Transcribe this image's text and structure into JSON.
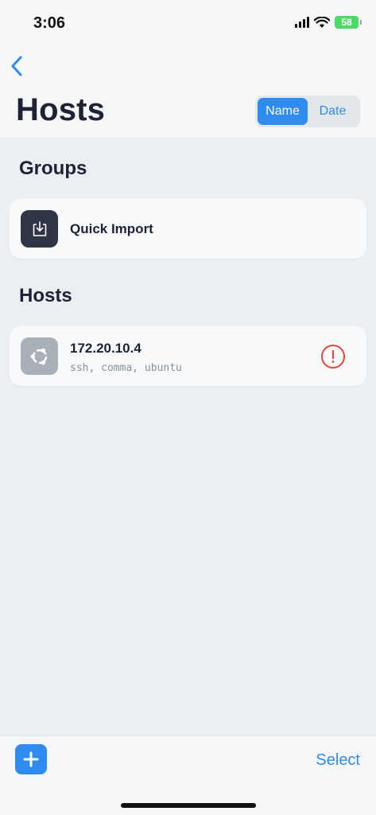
{
  "status_bar": {
    "time": "3:06",
    "battery": "58"
  },
  "header": {
    "back_icon": "chevron-left-icon",
    "title": "Hosts",
    "sort": {
      "options": [
        "Name",
        "Date"
      ],
      "selected": "Name"
    }
  },
  "groups": {
    "title": "Groups",
    "items": [
      {
        "label": "Quick Import",
        "icon": "download-tray-icon"
      }
    ]
  },
  "hosts": {
    "title": "Hosts",
    "items": [
      {
        "address": "172.20.10.4",
        "tags": "ssh, comma, ubuntu",
        "icon": "ubuntu-icon",
        "status_icon": "alert-circle-icon"
      }
    ]
  },
  "toolbar": {
    "add_icon": "plus-icon",
    "select_label": "Select"
  },
  "colors": {
    "accent": "#2e8cf0",
    "title": "#1e2235",
    "alert": "#e0473e",
    "background": "#eceff1",
    "card": "#f8f9fa"
  }
}
